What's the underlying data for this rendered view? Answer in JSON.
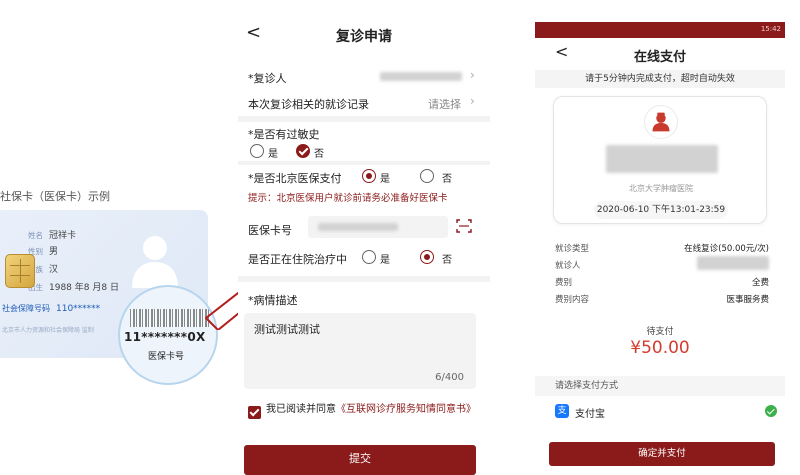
{
  "card_example": {
    "title": "社保卡（医保卡）示例",
    "name_label": "姓名",
    "name_value": "冠祥卡",
    "gender_label": "性别",
    "gender_value": "男",
    "ethnicity_label": "民族",
    "ethnicity_value": "汉",
    "birth_label": "出生",
    "birth_value": "1988 年8 月8 日",
    "ss_label": "社会保障号码",
    "ss_value": "110******",
    "issuer": "北京市人力资源和社会保障局  监制",
    "magnified_number": "11*******0X",
    "magnified_caption": "医保卡号"
  },
  "revisit_form": {
    "back_glyph": "<",
    "title": "复诊申请",
    "patient_label": "*复诊人",
    "record_label": "本次复诊相关的就诊记录",
    "record_value": "请选择",
    "allergy_label": "*是否有过敏史",
    "allergy_yes": "是",
    "allergy_no": "否",
    "beijing_label": "*是否北京医保支付",
    "beijing_yes": "是",
    "beijing_no": "否",
    "hint": "提示：北京医保用户就诊前请务必准备好医保卡",
    "card_no_label": "医保卡号",
    "inpatient_label": "是否正在住院治疗中",
    "inpatient_yes": "是",
    "inpatient_no": "否",
    "desc_label": "*病情描述",
    "desc_text": "测试测试测试",
    "desc_count": "6/400",
    "agree_prefix": "我已阅读并同意",
    "agree_link": "《互联网诊疗服务知情同意书》",
    "submit": "提交"
  },
  "online_pay": {
    "status_time": "15:42",
    "back_glyph": "<",
    "title": "在线支付",
    "timer_notice": "请于5分钟内完成支付，超时自动失效",
    "hospital": "北京大学肿瘤医院",
    "time_slot": "2020-06-10  下午13:01-23:59",
    "visit_type_label": "就诊类型",
    "visit_type_value": "在线复诊(50.00元/次)",
    "patient_label": "就诊人",
    "fee_type_label": "费别",
    "fee_type_value": "全费",
    "fee_content_label": "费别内容",
    "fee_content_value": "医事服务费",
    "due_label": "待支付",
    "amount": "¥50.00",
    "pay_method_title": "请选择支付方式",
    "alipay_icon_glyph": "支",
    "alipay_label": "支付宝",
    "confirm": "确定并支付"
  },
  "colors": {
    "brand": "#8b1a1a",
    "price": "#d43c2d",
    "alipay": "#1677ff",
    "ok": "#3cb04a"
  },
  "icons": [
    "chevron-left-icon",
    "chevron-right-icon",
    "scan-icon",
    "doctor-avatar-icon",
    "alipay-icon",
    "check-circle-icon",
    "arrow-icon"
  ]
}
